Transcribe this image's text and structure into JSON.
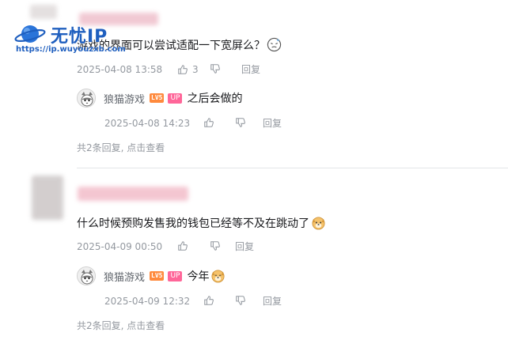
{
  "watermark": {
    "brand": "无忧IP",
    "url": "https://ip.wuyouzxb.com"
  },
  "comments": [
    {
      "text": "游戏的界面可以尝试适配一下宽屏么？",
      "date": "2025-04-08 13:58",
      "like_count": "3",
      "reply_label": "回复",
      "reply": {
        "username": "狼猫游戏",
        "level": "LV5",
        "up_badge": "UP",
        "text": "之后会做的",
        "date": "2025-04-08 14:23",
        "reply_label": "回复"
      },
      "more_replies": "共2条回复, 点击查看"
    },
    {
      "text": "什么时候预购发售我的钱包已经等不及在跳动了",
      "date": "2025-04-09 00:50",
      "reply_label": "回复",
      "reply": {
        "username": "狼猫游戏",
        "level": "LV5",
        "up_badge": "UP",
        "text": "今年",
        "date": "2025-04-09 12:32",
        "reply_label": "回复"
      },
      "more_replies": "共2条回复, 点击查看"
    }
  ],
  "icons": {
    "like": "thumbs-up-icon",
    "dislike": "thumbs-down-icon",
    "face_emoji": "awkward-face-emoji",
    "dog_emoji": "dog-emoji"
  },
  "colors": {
    "text": "#18191c",
    "meta": "#9499a0",
    "level_badge": "#ff8a3d",
    "up_badge": "#ff6699",
    "watermark": "#1f5fbf"
  }
}
